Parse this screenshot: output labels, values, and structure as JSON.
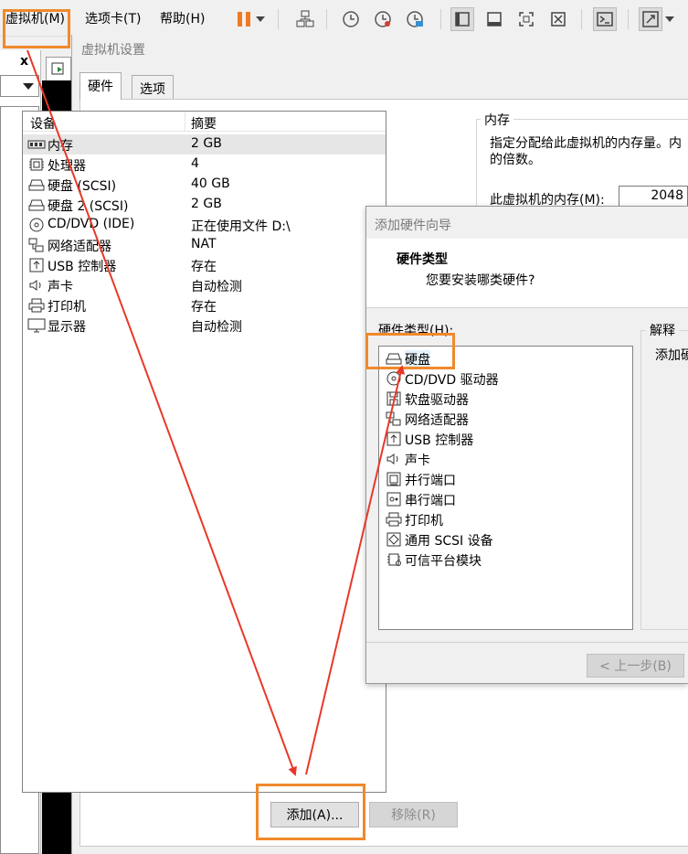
{
  "menubar": {
    "items": [
      "虚拟机(M)",
      "选项卡(T)",
      "帮助(H)"
    ]
  },
  "left_panel": {
    "close_label": "x"
  },
  "settings_dialog": {
    "title": "虚拟机设置",
    "tabs": [
      "硬件",
      "选项"
    ],
    "device_list": {
      "headers": [
        "设备",
        "摘要"
      ],
      "rows": [
        {
          "icon": "memory-icon",
          "name": "内存",
          "summary": "2 GB"
        },
        {
          "icon": "processor-icon",
          "name": "处理器",
          "summary": "4"
        },
        {
          "icon": "hard-disk-icon",
          "name": "硬盘 (SCSI)",
          "summary": "40 GB"
        },
        {
          "icon": "hard-disk-icon",
          "name": "硬盘 2 (SCSI)",
          "summary": "2 GB"
        },
        {
          "icon": "cd-dvd-icon",
          "name": "CD/DVD (IDE)",
          "summary": "正在使用文件 D:\\"
        },
        {
          "icon": "network-adapter-icon",
          "name": "网络适配器",
          "summary": "NAT"
        },
        {
          "icon": "usb-controller-icon",
          "name": "USB 控制器",
          "summary": "存在"
        },
        {
          "icon": "sound-card-icon",
          "name": "声卡",
          "summary": "自动检测"
        },
        {
          "icon": "printer-icon",
          "name": "打印机",
          "summary": "存在"
        },
        {
          "icon": "display-icon",
          "name": "显示器",
          "summary": "自动检测"
        }
      ]
    },
    "add_button": "添加(A)...",
    "remove_button": "移除(R)",
    "memory": {
      "legend": "内存",
      "description": "指定分配给此虚拟机的内存量。内\n的倍数。",
      "label": "此虚拟机的内存(M):",
      "value": "2048"
    }
  },
  "wizard": {
    "title": "添加硬件向导",
    "heading": "硬件类型",
    "subheading": "您要安装哪类硬件?",
    "list_label": "硬件类型(H):",
    "items": [
      {
        "icon": "hard-disk-icon",
        "name": "硬盘"
      },
      {
        "icon": "cd-dvd-icon",
        "name": "CD/DVD 驱动器"
      },
      {
        "icon": "floppy-icon",
        "name": "软盘驱动器"
      },
      {
        "icon": "network-adapter-icon",
        "name": "网络适配器"
      },
      {
        "icon": "usb-controller-icon",
        "name": "USB 控制器"
      },
      {
        "icon": "sound-card-icon",
        "name": "声卡"
      },
      {
        "icon": "parallel-port-icon",
        "name": "并行端口"
      },
      {
        "icon": "serial-port-icon",
        "name": "串行端口"
      },
      {
        "icon": "printer-icon",
        "name": "打印机"
      },
      {
        "icon": "scsi-device-icon",
        "name": "通用 SCSI 设备"
      },
      {
        "icon": "tpm-icon",
        "name": "可信平台模块"
      }
    ],
    "explain_legend": "解释",
    "explain_text": "添加硬",
    "back_button": "< 上一步(B)"
  },
  "colors": {
    "highlight": "#f0892c",
    "arrow": "#e8382a"
  }
}
